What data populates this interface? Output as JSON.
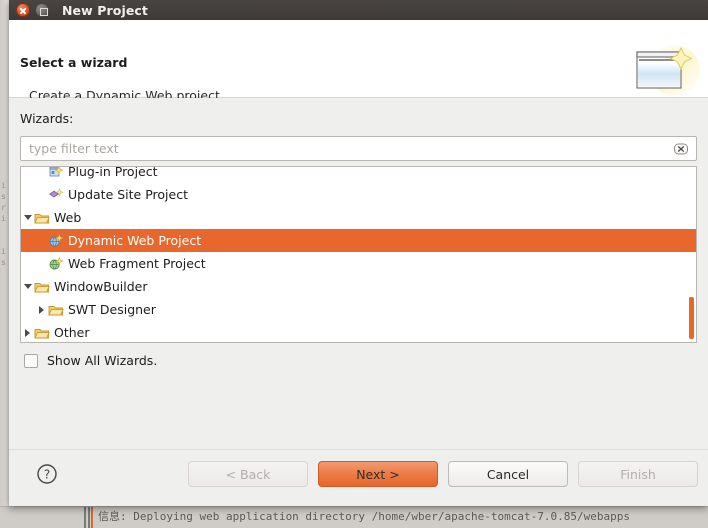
{
  "window": {
    "title": "New Project",
    "close_icon": "close-icon",
    "maximize_icon": "maximize-icon"
  },
  "header": {
    "title": "Select a wizard",
    "subtitle": "Create a Dynamic Web project",
    "icon": "wizard-page-sparkle-icon"
  },
  "body": {
    "wizards_label": "Wizards:",
    "filter": {
      "value": "",
      "placeholder": "type filter text",
      "clear_icon": "clear-filter-icon"
    },
    "tree": [
      {
        "label": "Plug-in Project",
        "indent": 1,
        "twisty": "none",
        "icon": "plugin-project-icon",
        "selected": false
      },
      {
        "label": "Update Site Project",
        "indent": 1,
        "twisty": "none",
        "icon": "update-site-project-icon",
        "selected": false
      },
      {
        "label": "Web",
        "indent": 0,
        "twisty": "open",
        "icon": "folder-icon",
        "selected": false
      },
      {
        "label": "Dynamic Web Project",
        "indent": 1,
        "twisty": "none",
        "icon": "dynamic-web-project-icon",
        "selected": true
      },
      {
        "label": "Web Fragment Project",
        "indent": 1,
        "twisty": "none",
        "icon": "web-fragment-project-icon",
        "selected": false
      },
      {
        "label": "WindowBuilder",
        "indent": 0,
        "twisty": "open",
        "icon": "folder-icon",
        "selected": false
      },
      {
        "label": "SWT Designer",
        "indent": 1,
        "twisty": "closed",
        "icon": "folder-icon",
        "selected": false
      },
      {
        "label": "Other",
        "indent": 0,
        "twisty": "closed",
        "icon": "folder-icon",
        "selected": false
      }
    ],
    "show_all_wizards": {
      "label": "Show All Wizards.",
      "checked": false
    }
  },
  "footer": {
    "help_icon": "help-icon",
    "buttons": [
      {
        "label": "< Back",
        "state": "disabled"
      },
      {
        "label": "Next >",
        "state": "primary"
      },
      {
        "label": "Cancel",
        "state": "normal"
      },
      {
        "label": "Finish",
        "state": "disabled"
      }
    ]
  },
  "background": {
    "console_line": "信息: Deploying web application directory /home/wber/apache-tomcat-7.0.85/webapps",
    "left_strip_text": "i\ns\nr\ni\n\n\ni\ns"
  },
  "colors": {
    "accent": "#e8672c",
    "titlebar": "#3d3936",
    "dialog_bg": "#efefee",
    "header_bg": "#ffffff"
  }
}
